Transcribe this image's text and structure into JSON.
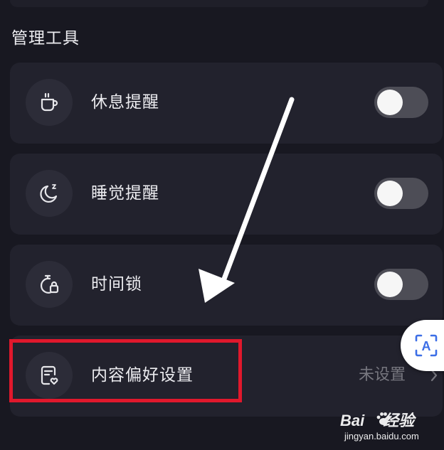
{
  "section": {
    "title": "管理工具"
  },
  "settings": [
    {
      "label": "休息提醒",
      "icon": "coffee-cup-icon",
      "control": "toggle",
      "enabled": false
    },
    {
      "label": "睡觉提醒",
      "icon": "moon-sleep-icon",
      "control": "toggle",
      "enabled": false
    },
    {
      "label": "时间锁",
      "icon": "timer-lock-icon",
      "control": "toggle",
      "enabled": false
    },
    {
      "label": "内容偏好设置",
      "icon": "doc-heart-icon",
      "control": "link",
      "value": "未设置"
    }
  ],
  "float_button": {
    "icon": "text-scan-icon",
    "glyph": "A"
  },
  "watermark": {
    "brand_prefix": "Bai",
    "brand_suffix": "经验",
    "domain": "jingyan.baidu.com"
  },
  "colors": {
    "background": "#181821",
    "card": "#22222d",
    "icon_circle": "#2c2c38",
    "toggle_off_track": "#4d4d56",
    "toggle_knob": "#f6f6f6",
    "secondary_text": "#77777f",
    "annotation_highlight": "#e0182c",
    "annotation_arrow": "#ffffff"
  }
}
